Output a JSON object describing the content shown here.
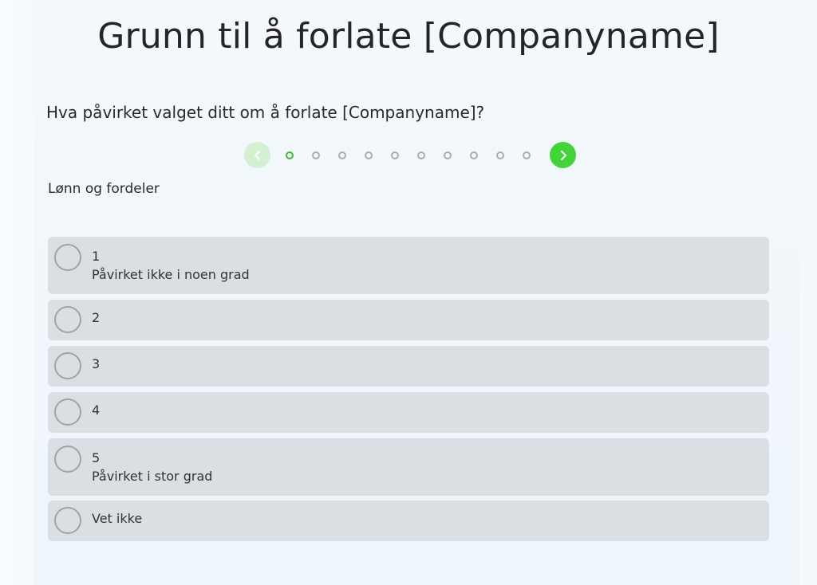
{
  "page": {
    "title": "Grunn til å forlate [Companyname]",
    "question": "Hva påvirket valget ditt om å forlate [Companyname]?",
    "category": "Lønn og fordeler"
  },
  "pager": {
    "prev_icon": "chevron-left-icon",
    "next_icon": "chevron-right-icon",
    "total_steps": 10,
    "current_step": 1
  },
  "options": [
    {
      "value": "1",
      "description": "Påvirket ikke i noen grad"
    },
    {
      "value": "2",
      "description": ""
    },
    {
      "value": "3",
      "description": ""
    },
    {
      "value": "4",
      "description": ""
    },
    {
      "value": "5",
      "description": "Påvirket i stor grad"
    },
    {
      "value": "Vet ikke",
      "description": ""
    }
  ],
  "colors": {
    "accent_green": "#44d43a",
    "accent_green_light": "#d3f0d3",
    "option_bg": "#d9dfe3"
  }
}
